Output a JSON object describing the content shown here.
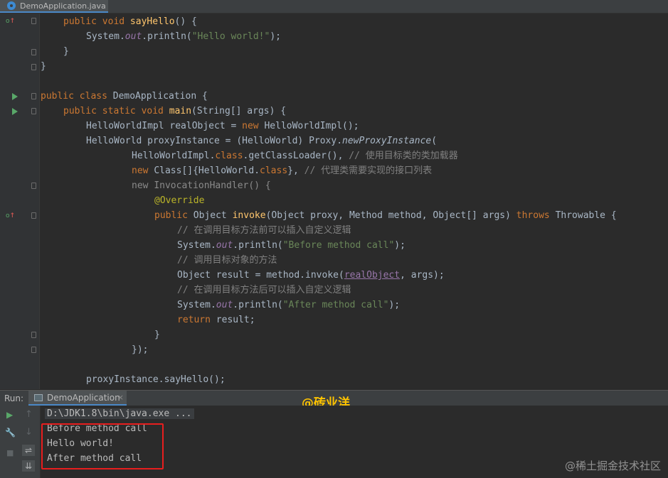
{
  "tab": {
    "title": "DemoApplication.java"
  },
  "code": {
    "l1": {
      "kw": "public void ",
      "fn": "sayHello",
      "rest": "() {"
    },
    "l2": {
      "a": "System.",
      "st": "out",
      "b": ".println(",
      "str": "\"Hello world!\"",
      "c": ");"
    },
    "l3": "}",
    "l4": "}",
    "l6": {
      "kw": "public class ",
      "cls": "DemoApplication",
      "rest": " {"
    },
    "l7": {
      "kw": "public static void ",
      "fn": "main",
      "rest": "(String[] args) {"
    },
    "l8": {
      "a": "HelloWorldImpl realObject = ",
      "kw": "new ",
      "b": "HelloWorldImpl();"
    },
    "l9": {
      "a": "HelloWorld proxyInstance = (HelloWorld) Proxy.",
      "it": "newProxyInstance",
      "b": "("
    },
    "l10": {
      "a": "HelloWorldImpl.",
      "kw": "class",
      "b": ".getClassLoader(), ",
      "cmt": "// 使用目标类的类加载器"
    },
    "l11": {
      "kw1": "new ",
      "a": "Class[]{HelloWorld.",
      "kw2": "class",
      "b": "}, ",
      "cmt": "// 代理类需要实现的接口列表"
    },
    "l12": {
      "kw": "new ",
      "rest": "InvocationHandler() {"
    },
    "l13": {
      "ann": "@Override"
    },
    "l14": {
      "kw1": "public ",
      "a": "Object ",
      "fn": "invoke",
      "b": "(Object proxy, Method method, Object[] args) ",
      "kw2": "throws ",
      "c": "Throwable {"
    },
    "l15": {
      "cmt": "// 在调用目标方法前可以插入自定义逻辑"
    },
    "l16": {
      "a": "System.",
      "st": "out",
      "b": ".println(",
      "str": "\"Before method call\"",
      "c": ");"
    },
    "l17": {
      "cmt": "// 调用目标对象的方法"
    },
    "l18": {
      "a": "Object result = method.invoke(",
      "fld": "realObject",
      "b": ", args);"
    },
    "l19": {
      "cmt": "// 在调用目标方法后可以插入自定义逻辑"
    },
    "l20": {
      "a": "System.",
      "st": "out",
      "b": ".println(",
      "str": "\"After method call\"",
      "c": ");"
    },
    "l21": {
      "kw": "return ",
      "rest": "result;"
    },
    "l22": "}",
    "l23": "});",
    "l25": "proxyInstance.sayHello();"
  },
  "run": {
    "label": "Run:",
    "tab_label": "DemoApplication",
    "close": "×"
  },
  "console": {
    "lines": [
      "D:\\JDK1.8\\bin\\java.exe ...",
      "Before method call",
      "Hello world!",
      "After method call"
    ]
  },
  "watermark": "@砖业洋__",
  "watermark2": "@稀土掘金技术社区",
  "icons": {
    "rerun": "▶",
    "up": "↑",
    "down": "↓",
    "wrench": "🔧",
    "stop": "■",
    "wrap": "⇌",
    "scroll": "⇊"
  },
  "colors": {
    "keyword": "#cc7832",
    "method": "#ffc66d",
    "string": "#6a8759",
    "comment": "#808080",
    "static_field": "#9876aa",
    "annotation": "#bbb529",
    "highlight_box": "#e81e1e",
    "watermark": "#ffc400"
  }
}
